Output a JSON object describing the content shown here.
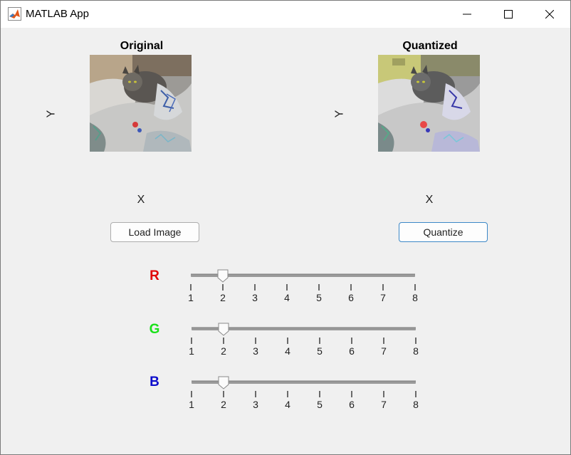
{
  "window": {
    "title": "MATLAB App"
  },
  "left_axes": {
    "title": "Original",
    "xlabel": "X",
    "ylabel": "Y"
  },
  "right_axes": {
    "title": "Quantized",
    "xlabel": "X",
    "ylabel": "Y"
  },
  "buttons": {
    "load": "Load Image",
    "quantize": "Quantize"
  },
  "sliders": [
    {
      "label": "R",
      "color": "#e00000",
      "value": 2,
      "min": 1,
      "max": 8,
      "ticks": [
        "1",
        "2",
        "3",
        "4",
        "5",
        "6",
        "7",
        "8"
      ]
    },
    {
      "label": "G",
      "color": "#19e119",
      "value": 2,
      "min": 1,
      "max": 8,
      "ticks": [
        "1",
        "2",
        "3",
        "4",
        "5",
        "6",
        "7",
        "8"
      ]
    },
    {
      "label": "B",
      "color": "#0c0ccc",
      "value": 2,
      "min": 1,
      "max": 8,
      "ticks": [
        "1",
        "2",
        "3",
        "4",
        "5",
        "6",
        "7",
        "8"
      ]
    }
  ],
  "icons": [
    "matlab-logo-icon",
    "minimize-icon",
    "maximize-icon",
    "close-icon"
  ]
}
